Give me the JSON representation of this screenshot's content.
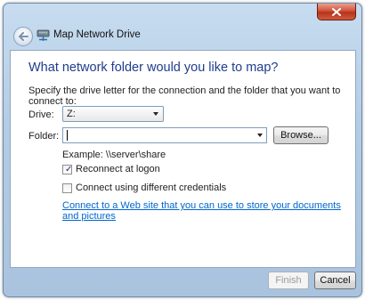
{
  "window": {
    "title": "Map Network Drive"
  },
  "dialog": {
    "heading": "What network folder would you like to map?",
    "instruction": "Specify the drive letter for the connection and the folder that you want to connect to:",
    "drive": {
      "label": "Drive:",
      "value": "Z:"
    },
    "folder": {
      "label": "Folder:",
      "value": "",
      "browse_label": "Browse..."
    },
    "example": "Example: \\\\server\\share",
    "reconnect": {
      "label": "Reconnect at logon",
      "checked": true
    },
    "different_credentials": {
      "label": "Connect using different credentials",
      "checked": false
    },
    "web_link": "Connect to a Web site that you can use to store your documents and pictures"
  },
  "footer": {
    "finish_label": "Finish",
    "finish_enabled": false,
    "cancel_label": "Cancel"
  },
  "colors": {
    "heading": "#1f3d8c",
    "link": "#0066cc",
    "close_button": "#c8432a"
  },
  "icons": {
    "back": "back-arrow-icon",
    "title": "network-drive-icon",
    "close": "close-icon"
  }
}
